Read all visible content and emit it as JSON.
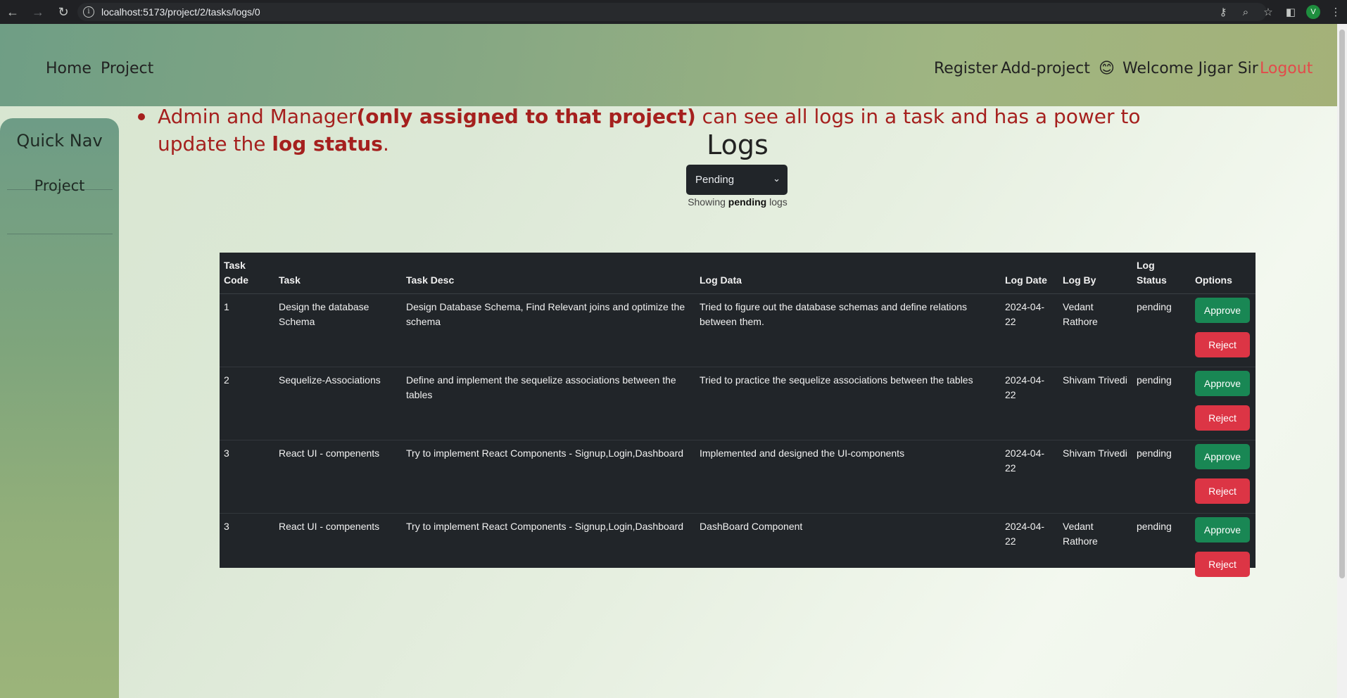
{
  "browser": {
    "url": "localhost:5173/project/2/tasks/logs/0",
    "avatar_letter": "V"
  },
  "header": {
    "home": "Home",
    "project": "Project",
    "register": "Register",
    "add_project": "Add-project",
    "welcome_emoji": "😊",
    "welcome": "Welcome Jigar Sir",
    "logout": "Logout"
  },
  "sidebar": {
    "title": "Quick Nav",
    "items": [
      {
        "label": "Project"
      }
    ]
  },
  "note": {
    "part1": "Admin and Manager",
    "part2": "(only assigned to that project)",
    "part3": " can see all logs in a task and has a power to update the ",
    "part4": "log status",
    "part5": "."
  },
  "logs": {
    "title": "Logs",
    "filter_value": "Pending",
    "showing_prefix": "Showing ",
    "showing_value": "pending",
    "showing_suffix": " logs"
  },
  "table": {
    "headers": [
      "Task Code",
      "Task",
      "Task Desc",
      "Log Data",
      "Log Date",
      "Log By",
      "Log Status",
      "Options"
    ],
    "rows": [
      {
        "code": "1",
        "task": "Design the database Schema",
        "desc": "Design Database Schema, Find Relevant joins and optimize the schema",
        "log": "Tried to figure out the database schemas and define relations between them.",
        "date": "2024-04-22",
        "by": "Vedant Rathore",
        "status": "pending"
      },
      {
        "code": "2",
        "task": "Sequelize-Associations",
        "desc": "Define and implement the sequelize associations between the tables",
        "log": "Tried to practice the sequelize associations between the tables",
        "date": "2024-04-22",
        "by": "Shivam Trivedi",
        "status": "pending"
      },
      {
        "code": "3",
        "task": "React UI - compenents",
        "desc": "Try to implement React Components - Signup,Login,Dashboard",
        "log": "Implemented and designed the UI-components",
        "date": "2024-04-22",
        "by": "Shivam Trivedi",
        "status": "pending"
      },
      {
        "code": "3",
        "task": "React UI - compenents",
        "desc": "Try to implement React Components - Signup,Login,Dashboard",
        "log": "DashBoard Component",
        "date": "2024-04-22",
        "by": "Vedant Rathore",
        "status": "pending"
      }
    ],
    "approve_label": "Approve",
    "reject_label": "Reject"
  }
}
